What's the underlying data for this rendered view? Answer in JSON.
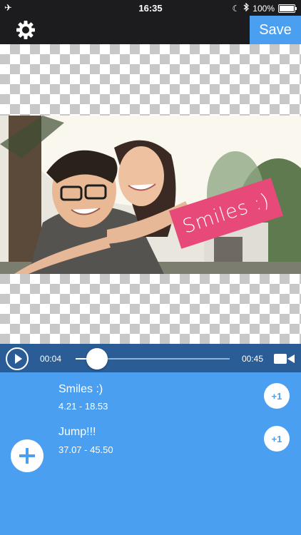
{
  "status": {
    "time": "16:35",
    "battery": "100%"
  },
  "header": {
    "save_label": "Save"
  },
  "sticker": {
    "text": "Smiles :)",
    "color": "#e74a78"
  },
  "player": {
    "current_time": "00:04",
    "end_time": "00:45",
    "progress": 0.14
  },
  "clips": [
    {
      "title": "Smiles :)",
      "range": "4.21 - 18.53",
      "action": "+1"
    },
    {
      "title": "Jump!!!",
      "range": "37.07 - 45.50",
      "action": "+1"
    }
  ],
  "colors": {
    "accent": "#4a9ff1",
    "player_bar": "#2a5d96",
    "toolbar": "#1c1c1e"
  },
  "icons": [
    "airplane-icon",
    "moon-icon",
    "bluetooth-icon",
    "battery-icon",
    "gear-icon",
    "play-icon",
    "video-camera-icon",
    "plus-icon"
  ]
}
